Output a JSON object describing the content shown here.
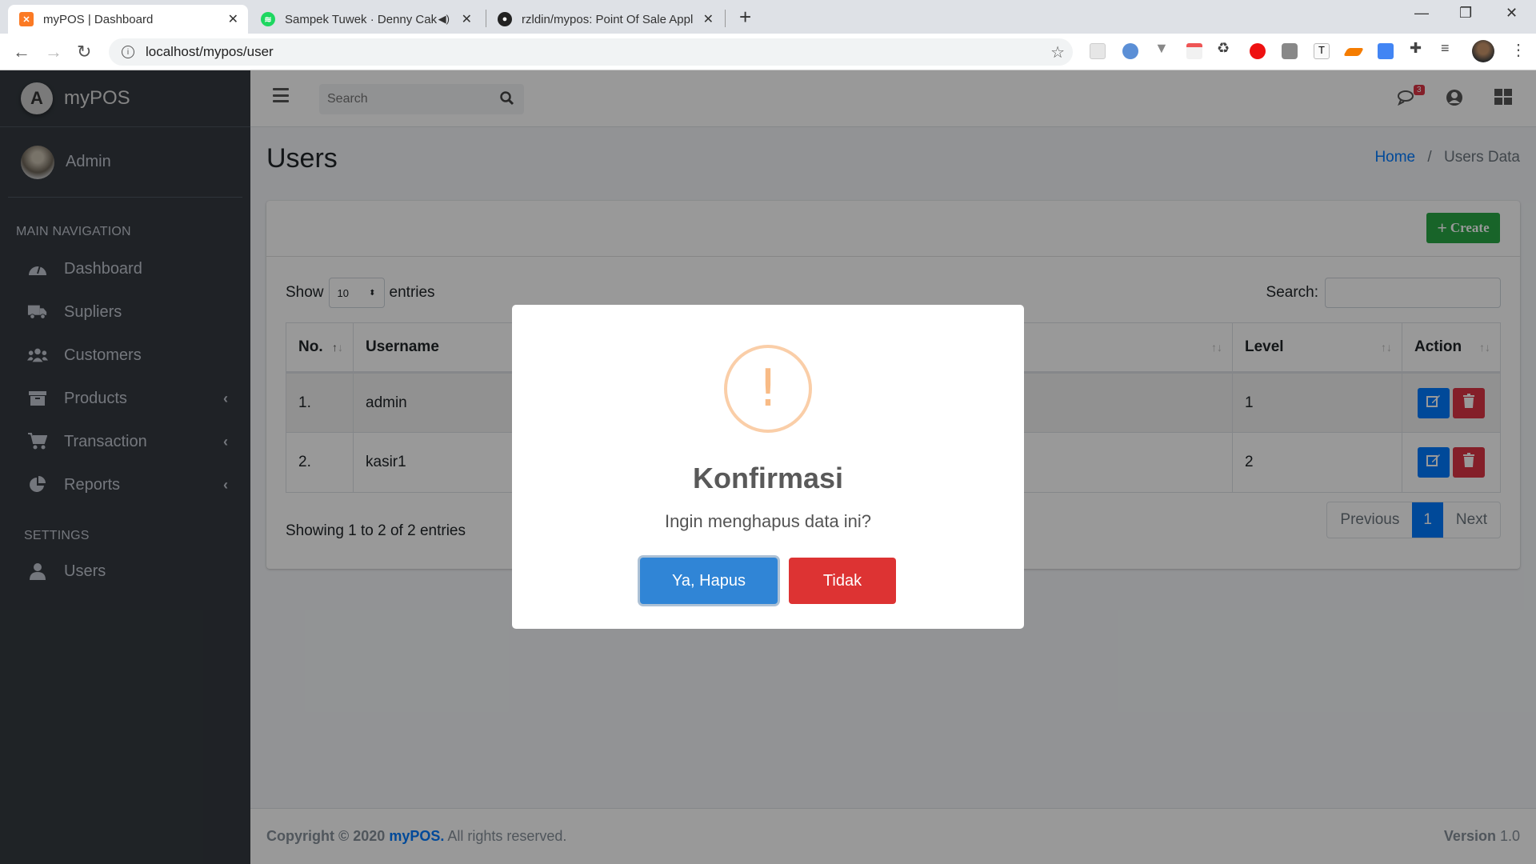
{
  "browser": {
    "tabs": [
      {
        "title": "myPOS | Dashboard",
        "active": true,
        "favicon": "xampp-icon",
        "favicon_color": "#fb7a24"
      },
      {
        "title": "Sampek Tuwek · Denny Cakn",
        "active": false,
        "favicon": "spotify-icon",
        "favicon_color": "#1ed760",
        "audio": true
      },
      {
        "title": "rzldin/mypos: Point Of Sale Appli",
        "active": false,
        "favicon": "github-icon",
        "favicon_color": "#222"
      }
    ],
    "url": "localhost/mypos/user"
  },
  "sidebar": {
    "brand": "myPOS",
    "user": "Admin",
    "main_header": "MAIN NAVIGATION",
    "items": [
      {
        "label": "Dashboard",
        "icon": "tachometer-icon",
        "has_submenu": false
      },
      {
        "label": "Supliers",
        "icon": "truck-icon",
        "has_submenu": false
      },
      {
        "label": "Customers",
        "icon": "users-icon",
        "has_submenu": false
      },
      {
        "label": "Products",
        "icon": "archive-icon",
        "has_submenu": true
      },
      {
        "label": "Transaction",
        "icon": "cart-icon",
        "has_submenu": true
      },
      {
        "label": "Reports",
        "icon": "pie-chart-icon",
        "has_submenu": true
      }
    ],
    "settings_header": "SETTINGS",
    "settings_items": [
      {
        "label": "Users",
        "icon": "user-icon"
      }
    ]
  },
  "topnav": {
    "search_placeholder": "Search",
    "messages_badge": "3"
  },
  "header": {
    "title": "Users",
    "breadcrumb": [
      "Home",
      "Users Data"
    ]
  },
  "card": {
    "create_label": "Create",
    "show_label": "Show",
    "entries_label": "entries",
    "page_length": "10",
    "search_label": "Search:",
    "columns": [
      "No.",
      "Username",
      "",
      "Level",
      "Action"
    ],
    "rows": [
      {
        "no": "1.",
        "username": "admin",
        "level": "1"
      },
      {
        "no": "2.",
        "username": "kasir1",
        "level": "2"
      }
    ],
    "info": "Showing 1 to 2 of 2 entries",
    "pagination": {
      "previous": "Previous",
      "current": "1",
      "next": "Next"
    }
  },
  "footer": {
    "copyright": "Copyright © 2020",
    "brand": "myPOS.",
    "rights": "All rights reserved.",
    "version_label": "Version",
    "version": "1.0"
  },
  "modal": {
    "icon": "warning-icon",
    "title": "Konfirmasi",
    "text": "Ingin menghapus data ini?",
    "confirm_label": "Ya, Hapus",
    "cancel_label": "Tidak"
  }
}
